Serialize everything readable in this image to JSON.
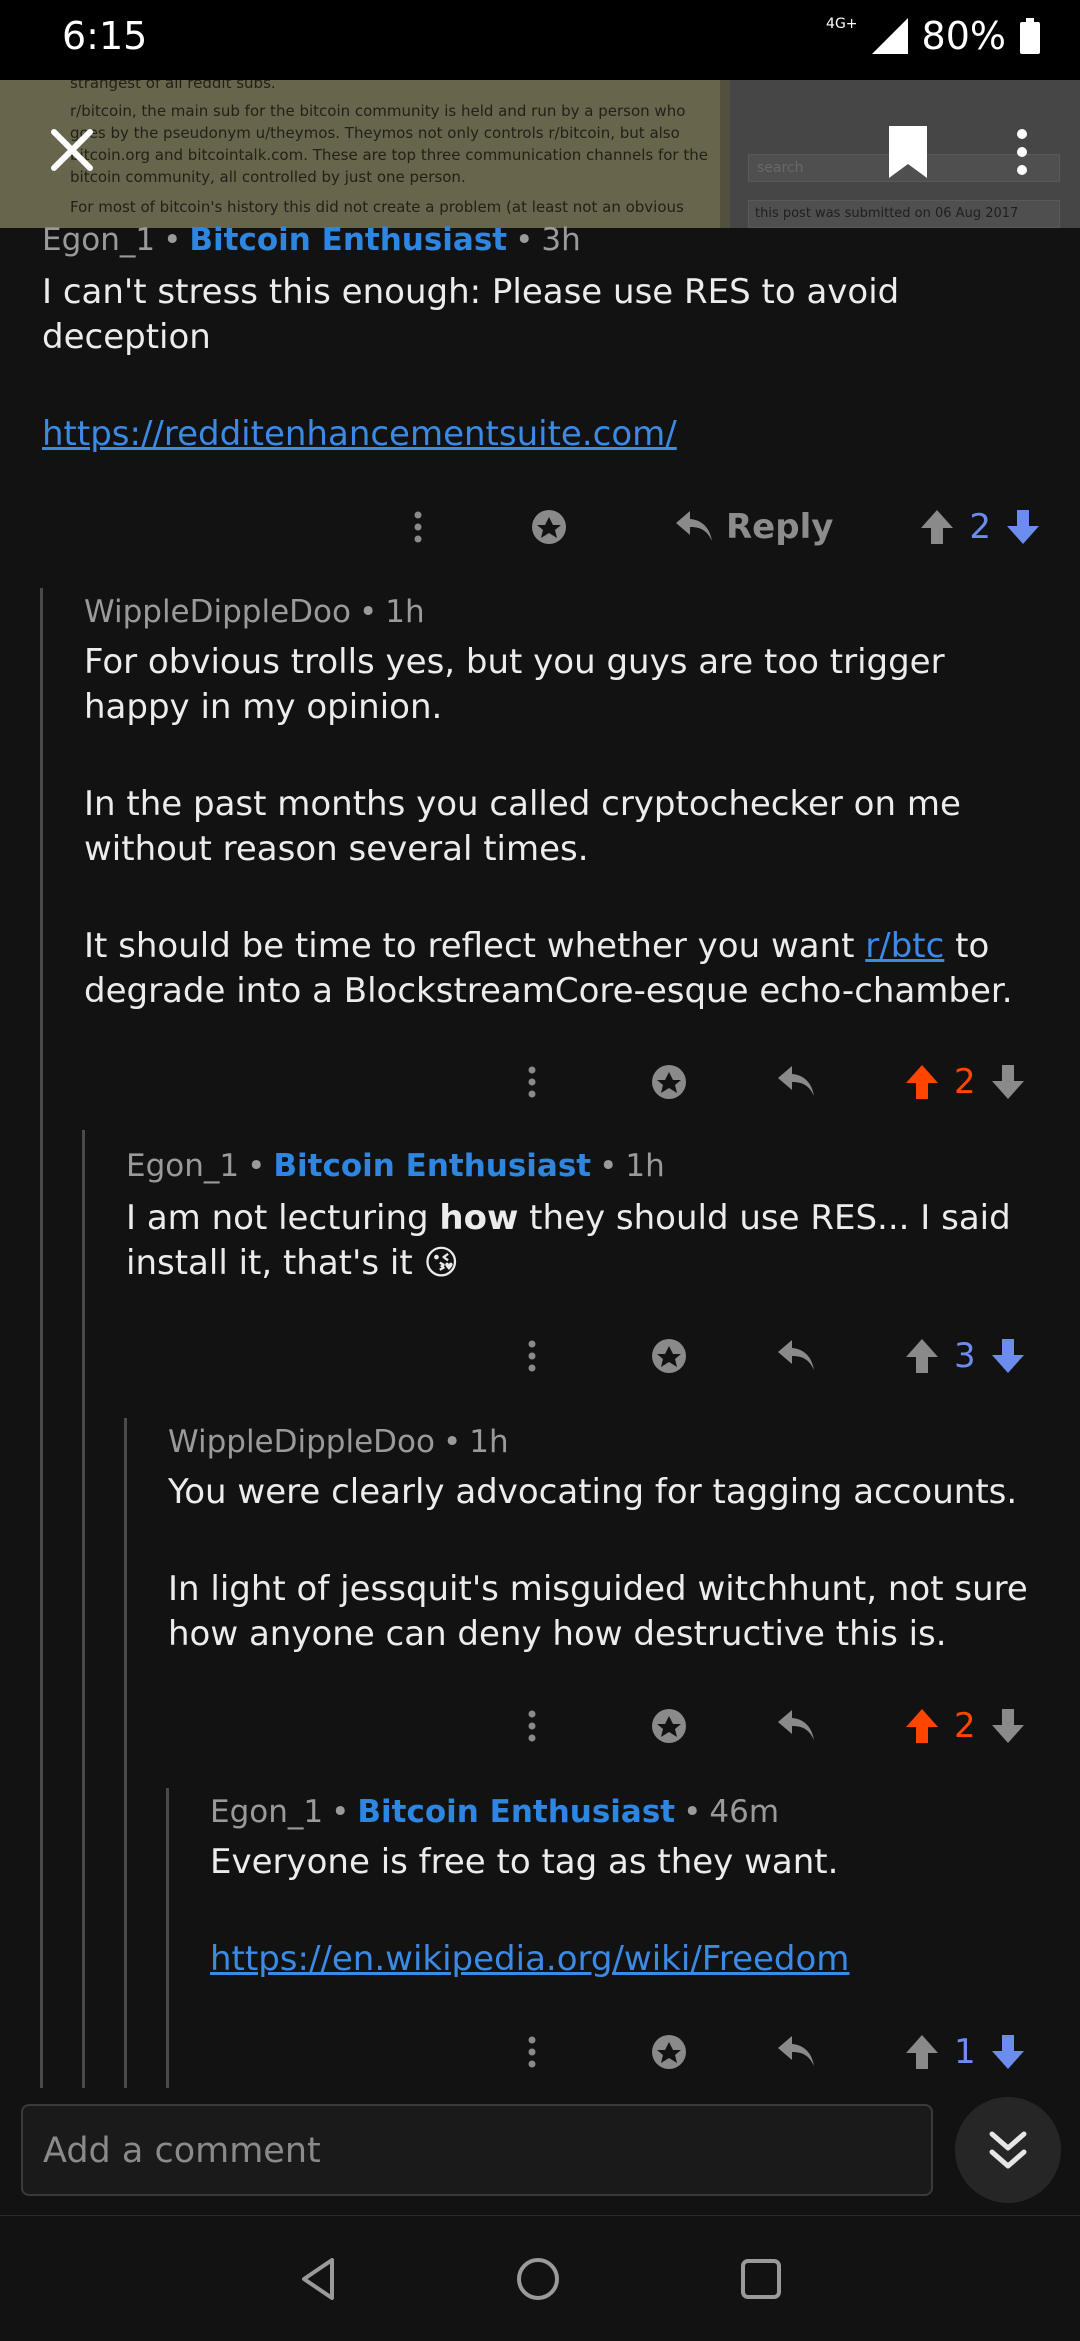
{
  "status_bar": {
    "time": "6:15",
    "network": "4G+",
    "battery": "80%"
  },
  "header": {
    "preview_lines": [
      "strangest of all reddit subs.",
      "r/bitcoin, the main sub for the bitcoin community is held and run by a person who",
      "goes by the pseudonym u/theymos. Theymos not only controls r/bitcoin, but also",
      "bitcoin.org and bitcointalk.com. These are top three communication channels for the",
      "bitcoin community, all controlled by just one person.",
      "For most of bitcoin's history this did not create a problem (at least not an obvious"
    ],
    "search_placeholder": "search",
    "submitted_text": "this post was submitted on 06 Aug 2017"
  },
  "comments": [
    {
      "author": "Egon_1",
      "flair": "Bitcoin Enthusiast",
      "age": "3h",
      "paragraphs": [
        "I can't stress this enough: Please use RES to avoid deception"
      ],
      "link": "https://redditenhancementsuite.com/",
      "reply_label": "Reply",
      "score": "2",
      "vote": "down"
    },
    {
      "author": "WippleDippleDoo",
      "age": "1h",
      "paragraphs": [
        "For obvious trolls yes, but you guys are too trigger happy in my opinion.",
        "In the past months you called cryptochecker on me without reason several times."
      ],
      "p3_before": "It should be time to reflect whether you want ",
      "p3_link": "r/btc",
      "p3_after": " to degrade into a BlockstreamCore-esque echo-chamber.",
      "score": "2",
      "vote": "up"
    },
    {
      "author": "Egon_1",
      "flair": "Bitcoin Enthusiast",
      "age": "1h",
      "text_before": "I am not lecturing ",
      "text_bold": "how",
      "text_after": " they should use RES... I said install it, that's it",
      "emoji": "😘",
      "score": "3",
      "vote": "down"
    },
    {
      "author": "WippleDippleDoo",
      "age": "1h",
      "paragraphs": [
        "You were clearly advocating for tagging accounts.",
        "In light of jessquit's misguided witchhunt, not sure how anyone can deny how destructive this is."
      ],
      "score": "2",
      "vote": "up"
    },
    {
      "author": "Egon_1",
      "flair": "Bitcoin Enthusiast",
      "age": "46m",
      "paragraphs": [
        "Everyone is free to tag as they want."
      ],
      "link": "https://en.wikipedia.org/wiki/Freedom",
      "score": "1",
      "vote": "down"
    }
  ],
  "composer": {
    "placeholder": "Add a comment"
  },
  "colors": {
    "upvote": "#ff4500",
    "downvote": "#6d8cf0",
    "flair": "#2f86e0",
    "link": "#3b8ae6",
    "background": "#121212"
  }
}
